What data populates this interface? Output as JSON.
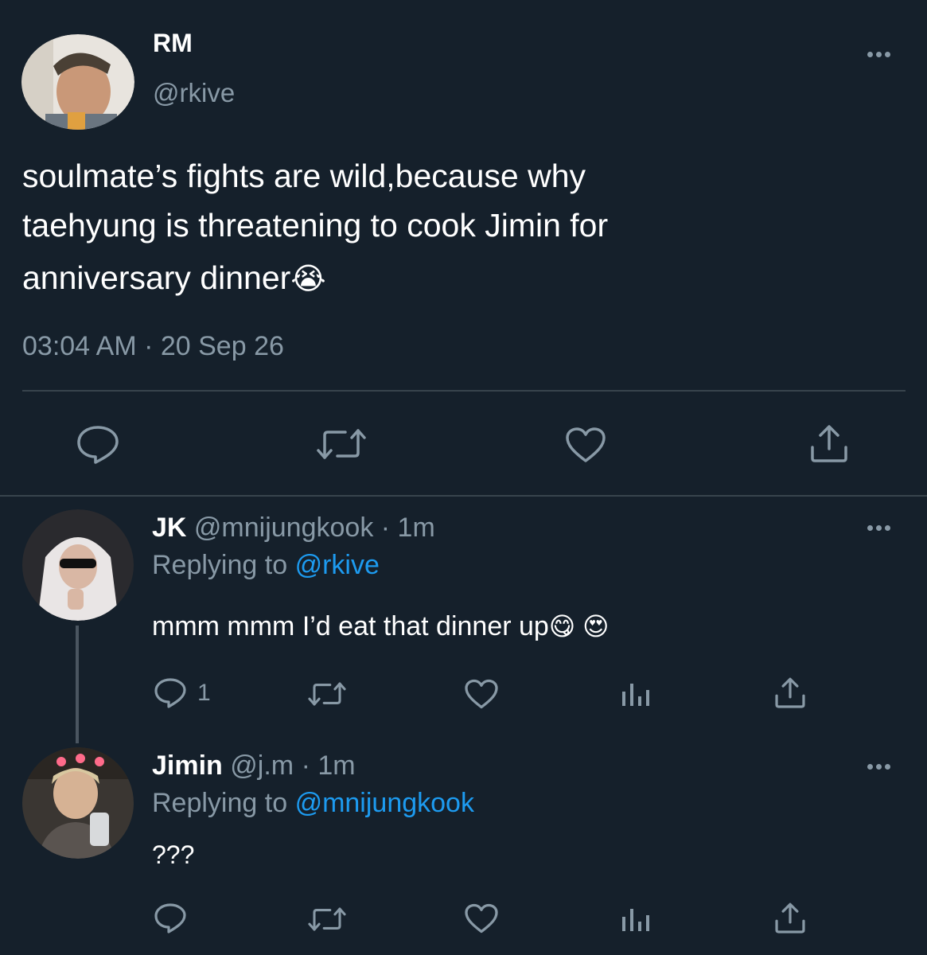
{
  "main_tweet": {
    "display_name": "RM",
    "handle": "@rkive",
    "text_line1": "soulmate’s fights are wild,because why",
    "text_line2": "taehyung is threatening to cook Jimin for",
    "text_line3": "anniversary dinner",
    "emoji": "😭",
    "timestamp": "03:04 AM · 20 Sep 26"
  },
  "replies": [
    {
      "display_name": "JK",
      "handle": "@mnijungkook",
      "time": "· 1m",
      "replying_prefix": "Replying to",
      "replying_to": "@rkive",
      "text": "mmm mmm I’d eat that dinner up",
      "emojis": "😋 😍",
      "reply_count": "1"
    },
    {
      "display_name": "Jimin",
      "handle": "@j.m",
      "time": "· 1m",
      "replying_prefix": "Replying to",
      "replying_to": "@mnijungkook",
      "text": "???"
    }
  ],
  "icons": [
    "more-icon",
    "reply-icon",
    "retweet-icon",
    "like-icon",
    "share-icon",
    "analytics-icon"
  ],
  "colors": {
    "background": "#15202b",
    "muted": "#8899a6",
    "link": "#1d9bf0",
    "divider": "#38444d"
  }
}
